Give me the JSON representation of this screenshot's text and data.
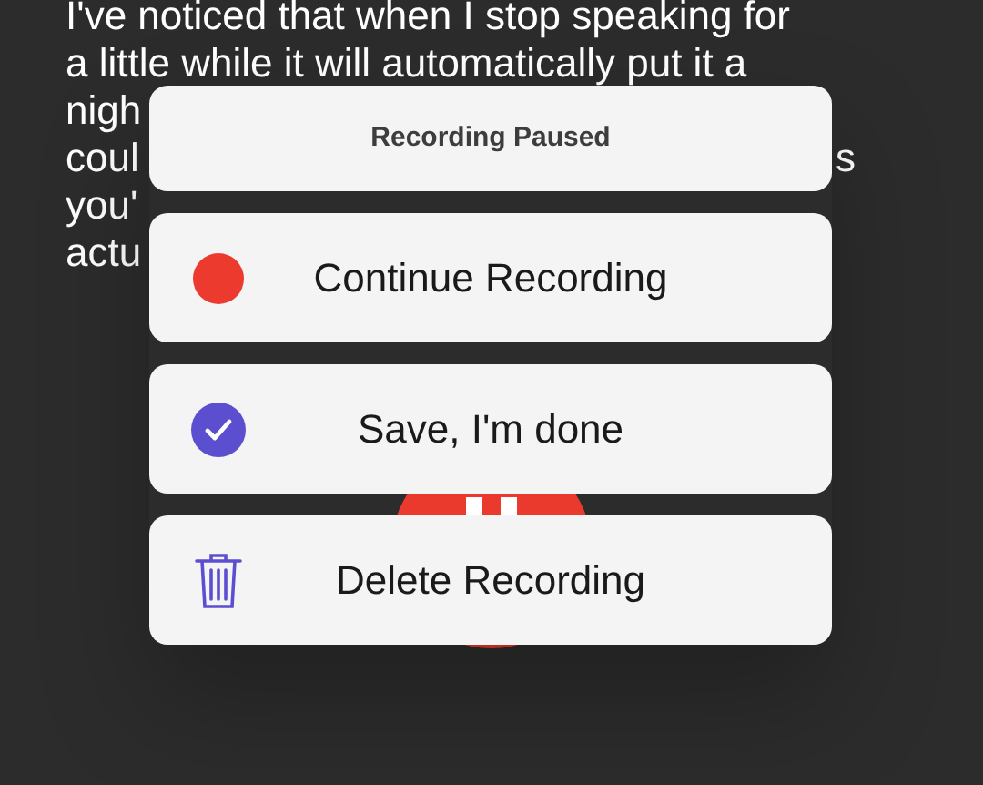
{
  "background_text": [
    {
      "text": "I've noticed that when I stop speaking for"
    },
    {
      "text": "a little while it will automatically put it a"
    },
    {
      "text": "nigh"
    },
    {
      "text": "coul",
      "right_fragment": "s"
    },
    {
      "text": "you'"
    },
    {
      "text": "actu"
    }
  ],
  "sheet": {
    "title": "Recording Paused",
    "actions": [
      {
        "kind": "record",
        "label": "Continue Recording"
      },
      {
        "kind": "save",
        "label": "Save, I'm done"
      },
      {
        "kind": "delete",
        "label": "Delete Recording"
      }
    ]
  }
}
